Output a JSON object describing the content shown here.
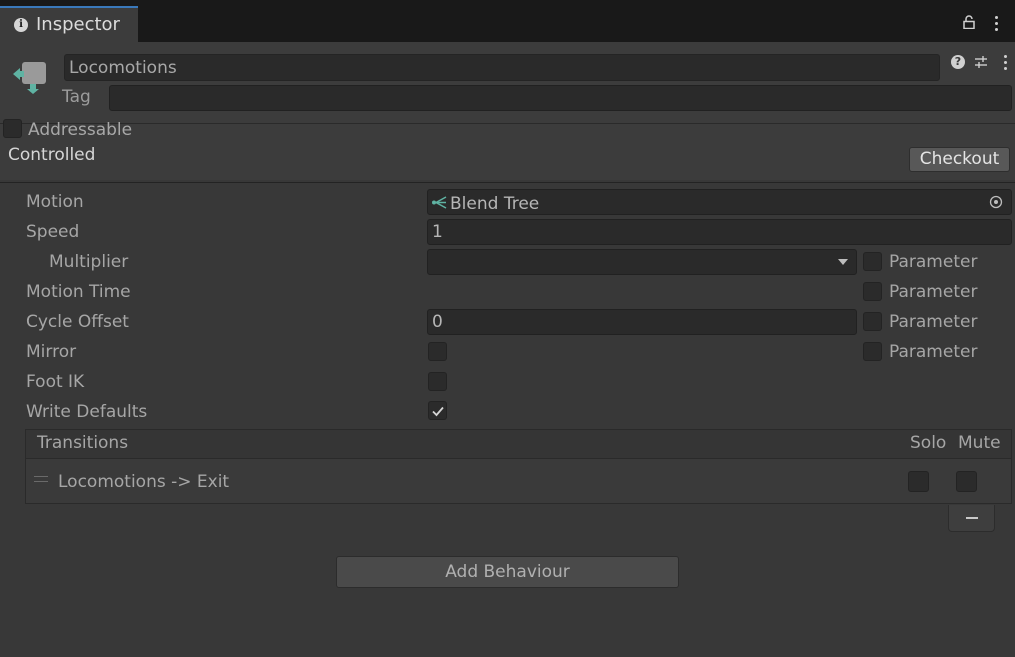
{
  "tab": {
    "label": "Inspector"
  },
  "header": {
    "name_value": "Locomotions",
    "tag_label": "Tag",
    "tag_value": "",
    "addressable_label": "Addressable",
    "controlled_label": "Controlled",
    "checkout_label": "Checkout"
  },
  "props": {
    "motion_label": "Motion",
    "motion_value": "Blend Tree",
    "speed_label": "Speed",
    "speed_value": "1",
    "multiplier_label": "Multiplier",
    "multiplier_value": "",
    "motion_time_label": "Motion Time",
    "cycle_offset_label": "Cycle Offset",
    "cycle_offset_value": "0",
    "mirror_label": "Mirror",
    "foot_ik_label": "Foot IK",
    "write_defaults_label": "Write Defaults",
    "write_defaults_checked": true,
    "parameter_label": "Parameter"
  },
  "transitions": {
    "header": "Transitions",
    "solo_label": "Solo",
    "mute_label": "Mute",
    "items": [
      {
        "label": "Locomotions -> Exit"
      }
    ]
  },
  "add_behaviour_label": "Add Behaviour",
  "colors": {
    "tab_accent": "#3a79bb",
    "state_icon": "#5fb3a3",
    "background": "#383838"
  }
}
